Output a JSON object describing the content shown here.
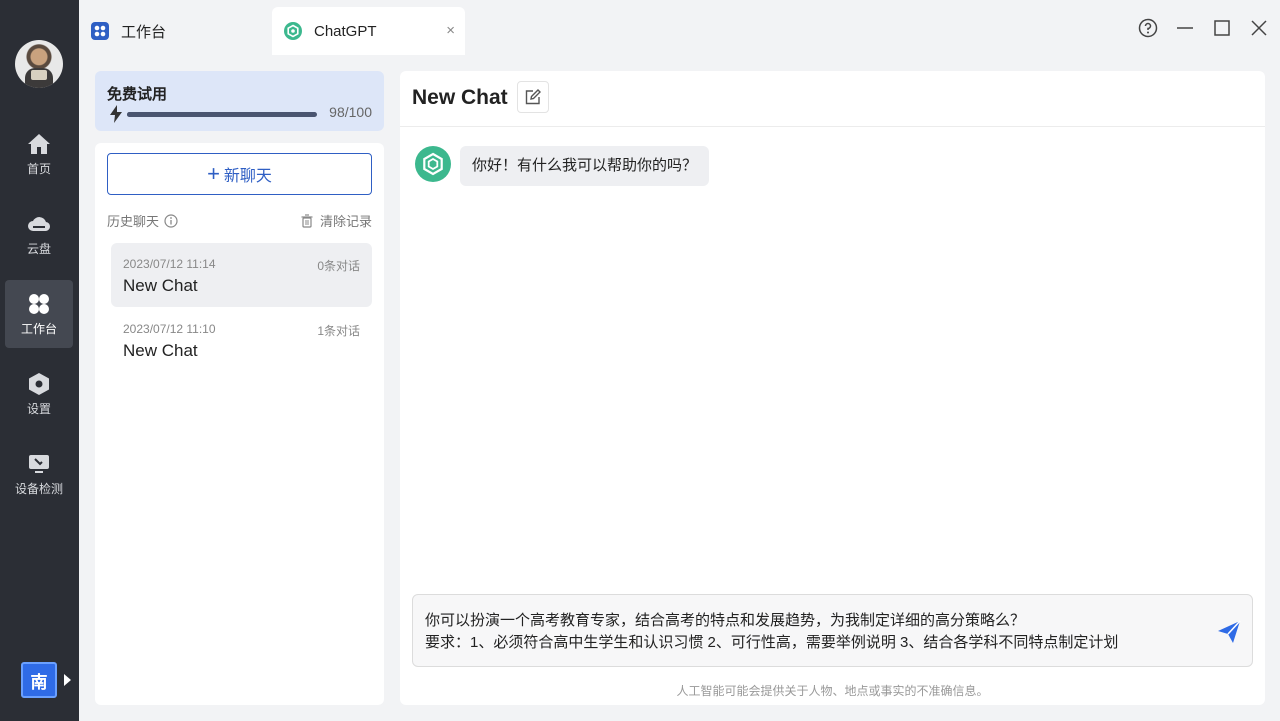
{
  "app": {
    "colors": {
      "rail_bg": "#2b2e35",
      "accent": "#2f5fc4",
      "bot_green": "#3cb88e"
    }
  },
  "rail": {
    "items": [
      {
        "label": "首页",
        "icon": "home-icon"
      },
      {
        "label": "云盘",
        "icon": "cloud-icon"
      },
      {
        "label": "工作台",
        "icon": "workbench-icon",
        "active": true
      },
      {
        "label": "设置",
        "icon": "settings-icon"
      },
      {
        "label": "设备检测",
        "icon": "device-check-icon"
      }
    ],
    "user_badge": "南"
  },
  "tabs": [
    {
      "label": "工作台",
      "icon": "workbench-app-icon"
    },
    {
      "label": "ChatGPT",
      "icon": "chatgpt-icon",
      "active": true,
      "close": "×"
    }
  ],
  "trial": {
    "title": "免费试用",
    "count": "98/100",
    "progress": 0.98
  },
  "history": {
    "new_chat_label": "新聊天",
    "header_label": "历史聊天",
    "clear_label": "清除记录",
    "items": [
      {
        "date": "2023/07/12 11:14",
        "count": "0条对话",
        "title": "New Chat",
        "active": true
      },
      {
        "date": "2023/07/12 11:10",
        "count": "1条对话",
        "title": "New Chat"
      }
    ]
  },
  "chat": {
    "title": "New Chat",
    "messages": [
      {
        "role": "assistant",
        "text": "你好！有什么我可以帮助你的吗？"
      }
    ],
    "input_line1": "你可以扮演一个高考教育专家，结合高考的特点和发展趋势，为我制定详细的高分策略么？",
    "input_line2": "要求：1、必须符合高中生学生和认识习惯 2、可行性高，需要举例说明 3、结合各学科不同特点制定计划",
    "disclaimer": "人工智能可能会提供关于人物、地点或事实的不准确信息。"
  }
}
